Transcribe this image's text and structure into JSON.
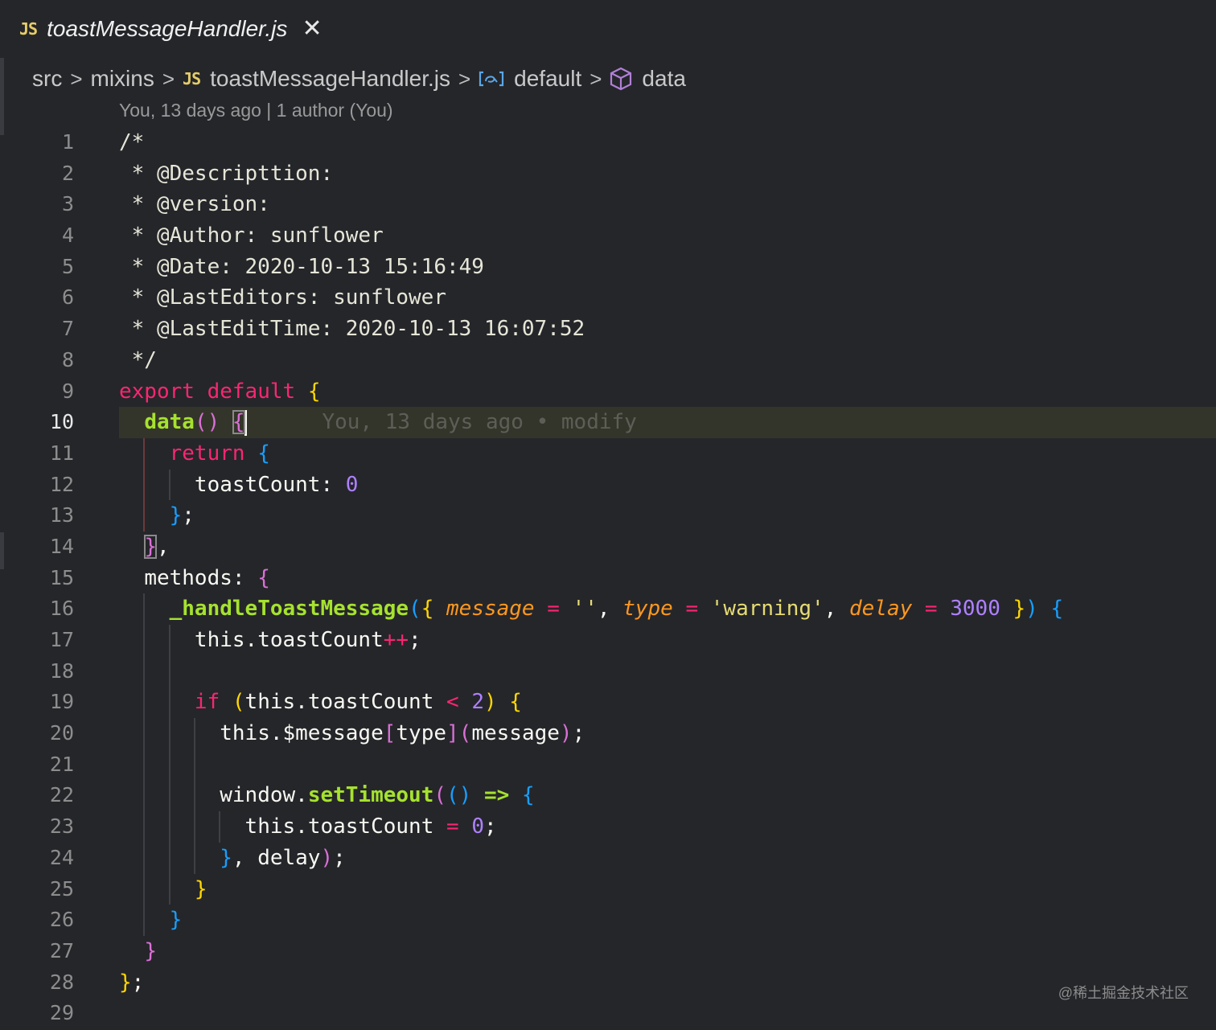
{
  "tab": {
    "icon": "JS",
    "title": "toastMessageHandler.js",
    "close": "✕"
  },
  "breadcrumb": {
    "items": [
      "src",
      "mixins",
      "toastMessageHandler.js",
      "default",
      "data"
    ],
    "js_icon": "JS",
    "separator": ">",
    "icons": [
      "js-file-icon",
      "symbol-variable-icon",
      "symbol-cube-icon"
    ]
  },
  "blame": {
    "text": "You, 13 days ago | 1 author (You)"
  },
  "editor": {
    "line_numbers": [
      "1",
      "2",
      "3",
      "4",
      "5",
      "6",
      "7",
      "8",
      "9",
      "10",
      "11",
      "12",
      "13",
      "14",
      "15",
      "16",
      "17",
      "18",
      "19",
      "20",
      "21",
      "22",
      "23",
      "24",
      "25",
      "26",
      "27",
      "28",
      "29"
    ],
    "active_line": "10",
    "inline_blame": "You, 13 days ago • modify",
    "lines": [
      "/*",
      " * @Descripttion:",
      " * @version:",
      " * @Author: sunflower",
      " * @Date: 2020-10-13 15:16:49",
      " * @LastEditors: sunflower",
      " * @LastEditTime: 2020-10-13 16:07:52",
      " */",
      "export default {",
      "  data() {",
      "    return {",
      "      toastCount: 0",
      "    };",
      "  },",
      "  methods: {",
      "    _handleToastMessage({ message = '', type = 'warning', delay = 3000 }) {",
      "      this.toastCount++;",
      "",
      "      if (this.toastCount < 2) {",
      "        this.$message[type](message);",
      "",
      "        window.setTimeout(() => {",
      "          this.toastCount = 0;",
      "        }, delay);",
      "      }",
      "    }",
      "  }",
      "};",
      ""
    ]
  },
  "watermark": "@稀土掘金技术社区",
  "colors": {
    "background": "#25262a",
    "keyword": "#f92672",
    "function": "#a6e22e",
    "parameter": "#fd971f",
    "number": "#ae81ff",
    "string": "#e6db74",
    "bracket_yellow": "#ffd700",
    "bracket_purple": "#da70d6",
    "bracket_blue": "#179fff",
    "js_badge": "#e6cd69"
  }
}
